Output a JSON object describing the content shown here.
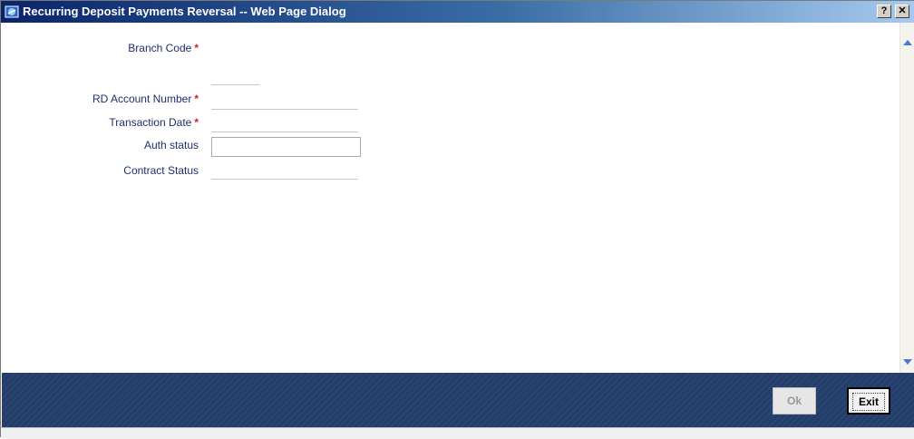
{
  "window": {
    "title": "Recurring Deposit Payments Reversal -- Web Page Dialog",
    "help_label": "?",
    "close_label": "✕"
  },
  "form": {
    "fields": [
      {
        "label": "Branch Code",
        "required": "*",
        "value": ""
      },
      {
        "label": "RD Account Number",
        "required": "*",
        "value": ""
      },
      {
        "label": "Transaction Date",
        "required": "*",
        "value": ""
      },
      {
        "label": "Auth status",
        "value": ""
      },
      {
        "label": "Contract Status",
        "value": ""
      }
    ]
  },
  "footer": {
    "ok_label": "Ok",
    "exit_label": "Exit"
  },
  "icons": {
    "app": "ie-dialog-icon",
    "scroll_up": "scroll-up-arrow-icon",
    "scroll_down": "scroll-down-arrow-icon"
  },
  "colors": {
    "title_bar": "#0a246a",
    "label_text": "#1f2f6b",
    "required_mark": "#d21f1f",
    "footer_bg": "#243e6b"
  }
}
